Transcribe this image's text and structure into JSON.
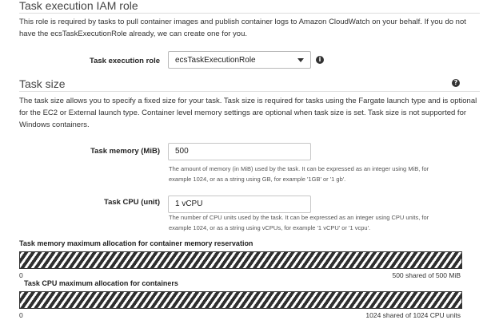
{
  "iam_section": {
    "title": "Task execution IAM role",
    "description": "This role is required by tasks to pull container images and publish container logs to Amazon CloudWatch on your behalf. If you do not have the ecsTaskExecutionRole already, we can create one for you.",
    "description_line1": "This role is required by tasks to pull container images and publish container logs to Amazon CloudWatch on your behalf. If you do not",
    "description_line2": "have the ecsTaskExecutionRole already, we can create one for you.",
    "execution_role_label": "Task execution role",
    "execution_role_value": "ecsTaskExecutionRole",
    "info_icon": "info-icon"
  },
  "task_size": {
    "title": "Task size",
    "help_icon": "help-icon",
    "description_line1": "The task size allows you to specify a fixed size for your task. Task size is required for tasks using the Fargate launch type and is optional",
    "description_line2": "for the EC2 or External launch type. Container level memory settings are optional when task size is set. Task size is not supported for",
    "description_line3": "Windows containers.",
    "memory_label": "Task memory (MiB)",
    "memory_value": "500",
    "memory_help_line1": "The amount of memory (in MiB) used by the task. It can be expressed as an integer using MiB, for",
    "memory_help_line2": "example 1024, or as a string using GB, for example '1GB' or '1 gb'.",
    "cpu_label": "Task CPU (unit)",
    "cpu_value": "1 vCPU",
    "cpu_help_line1": "The number of CPU units used by the task. It can be expressed as an integer using CPU units, for",
    "cpu_help_line2": "example 1024, or as a string using vCPUs, for example '1 vCPU' or '1 vcpu'."
  },
  "memory_allocation": {
    "label": "Task memory maximum allocation for container memory reservation",
    "min_label": "0",
    "summary": "500 shared of 500 MiB",
    "fill_fraction": 1.0
  },
  "cpu_allocation": {
    "label": "Task CPU maximum allocation for containers",
    "min_label": "0",
    "summary": "1024 shared of 1024 CPU units",
    "fill_fraction": 1.0
  }
}
